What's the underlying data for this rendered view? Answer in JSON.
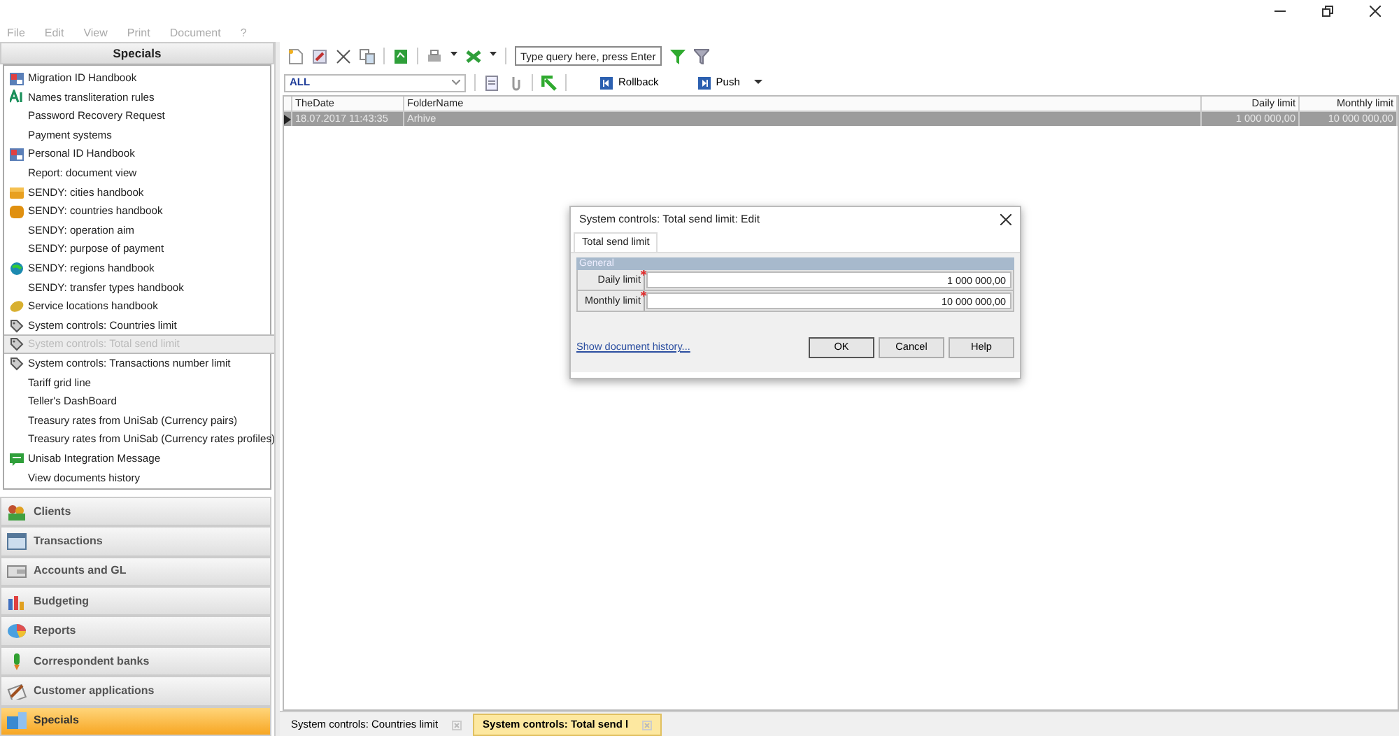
{
  "menu": [
    {
      "label": "File"
    },
    {
      "label": "Edit"
    },
    {
      "label": "View"
    },
    {
      "label": "Print"
    },
    {
      "label": "Document"
    },
    {
      "label": "?"
    }
  ],
  "sidebar": {
    "title": "Specials",
    "items": [
      {
        "label": "Migration ID Handbook",
        "selected": false
      },
      {
        "label": "Names transliteration rules",
        "selected": false
      },
      {
        "label": "Password Recovery Request",
        "selected": false
      },
      {
        "label": "Payment systems",
        "selected": false
      },
      {
        "label": "Personal ID Handbook",
        "selected": false
      },
      {
        "label": "Report: document view",
        "selected": false
      },
      {
        "label": "SENDY: cities handbook",
        "selected": false
      },
      {
        "label": "SENDY: countries handbook",
        "selected": false
      },
      {
        "label": "SENDY: operation aim",
        "selected": false
      },
      {
        "label": "SENDY: purpose of payment",
        "selected": false
      },
      {
        "label": "SENDY: regions handbook",
        "selected": false
      },
      {
        "label": "SENDY: transfer types handbook",
        "selected": false
      },
      {
        "label": "Service locations handbook",
        "selected": false
      },
      {
        "label": "System controls: Countries limit",
        "selected": false
      },
      {
        "label": "System controls: Total send limit",
        "selected": true
      },
      {
        "label": "System controls: Transactions number limit",
        "selected": false
      },
      {
        "label": "Tariff grid line",
        "selected": false
      },
      {
        "label": "Teller's DashBoard",
        "selected": false
      },
      {
        "label": "Treasury rates from UniSab (Currency pairs)",
        "selected": false
      },
      {
        "label": "Treasury rates from UniSab (Currency rates profiles)",
        "selected": false
      },
      {
        "label": "Unisab Integration Message",
        "selected": false
      },
      {
        "label": "View documents history",
        "selected": false
      }
    ],
    "sections": [
      {
        "label": "Clients",
        "selected": false
      },
      {
        "label": "Transactions",
        "selected": false
      },
      {
        "label": "Accounts and GL",
        "selected": false
      },
      {
        "label": "Budgeting",
        "selected": false
      },
      {
        "label": "Reports",
        "selected": false
      },
      {
        "label": "Correspondent banks",
        "selected": false
      },
      {
        "label": "Customer applications",
        "selected": false
      },
      {
        "label": "Specials",
        "selected": true
      }
    ]
  },
  "toolbar": {
    "search": {
      "placeholder": "Type query here, press Enter"
    },
    "filter": {
      "value": "ALL"
    },
    "buttons": [
      {
        "label": "Rollback"
      },
      {
        "label": "Push"
      }
    ]
  },
  "table": {
    "columns": [
      "TheDate",
      "FolderName",
      "Daily limit",
      "Monthly limit"
    ],
    "rows": [
      {
        "cells": [
          "18.07.2017 11:43:35",
          "Arhive",
          "1 000 000,00",
          "10 000 000,00"
        ],
        "selected": true
      }
    ]
  },
  "dialog": {
    "title": "System controls: Total send limit: Edit",
    "tab": "Total send limit",
    "group": "General",
    "fields": [
      {
        "label": "Daily limit",
        "value": "1 000 000,00",
        "required": true
      },
      {
        "label": "Monthly limit",
        "value": "10 000 000,00",
        "required": true
      }
    ],
    "link": "Show document history...",
    "buttons": [
      "OK",
      "Cancel",
      "Help"
    ]
  },
  "document_tabs": [
    {
      "label": "System controls: Countries limit",
      "selected": false
    },
    {
      "label": "System controls: Total send l",
      "selected": true
    }
  ]
}
